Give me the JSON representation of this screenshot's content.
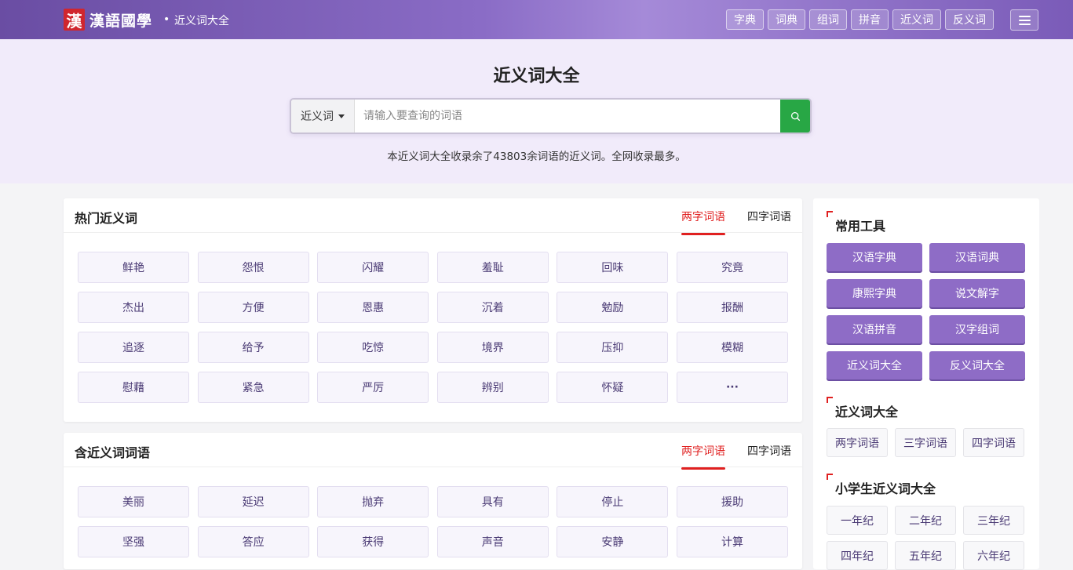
{
  "header": {
    "logo_seal": "漢",
    "logo_text": "漢語國學",
    "crumb_sep": "•",
    "crumb": "近义词大全",
    "nav": [
      "字典",
      "词典",
      "组词",
      "拼音",
      "近义词",
      "反义词"
    ]
  },
  "hero": {
    "title": "近义词大全",
    "search_type": "近义词",
    "search_placeholder": "请输入要查询的词语",
    "description": "本近义词大全收录余了43803余词语的近义词。全网收录最多。"
  },
  "hot": {
    "title": "热门近义词",
    "tabs": [
      "两字词语",
      "四字词语"
    ],
    "words": [
      "鲜艳",
      "怨恨",
      "闪耀",
      "羞耻",
      "回味",
      "究竟",
      "杰出",
      "方便",
      "恩惠",
      "沉着",
      "勉励",
      "报酬",
      "追逐",
      "给予",
      "吃惊",
      "境界",
      "压抑",
      "模糊",
      "慰藉",
      "紧急",
      "严厉",
      "辨别",
      "怀疑",
      "···"
    ]
  },
  "contains": {
    "title": "含近义词词语",
    "tabs": [
      "两字词语",
      "四字词语"
    ],
    "words": [
      "美丽",
      "延迟",
      "抛弃",
      "具有",
      "停止",
      "援助",
      "坚强",
      "答应",
      "获得",
      "声音",
      "安静",
      "计算"
    ]
  },
  "sidebar": {
    "tools_title": "常用工具",
    "tools": [
      "汉语字典",
      "汉语词典",
      "康熙字典",
      "说文解字",
      "汉语拼音",
      "汉字组词",
      "近义词大全",
      "反义词大全"
    ],
    "synonyms_title": "近义词大全",
    "synonyms": [
      "两字词语",
      "三字词语",
      "四字词语"
    ],
    "pupil_title": "小学生近义词大全",
    "grades": [
      "一年纪",
      "二年纪",
      "三年纪",
      "四年纪",
      "五年纪",
      "六年纪"
    ]
  },
  "colors": {
    "accent": "#8e6cc6",
    "tab_active": "#e02020",
    "search_button": "#28a745"
  }
}
